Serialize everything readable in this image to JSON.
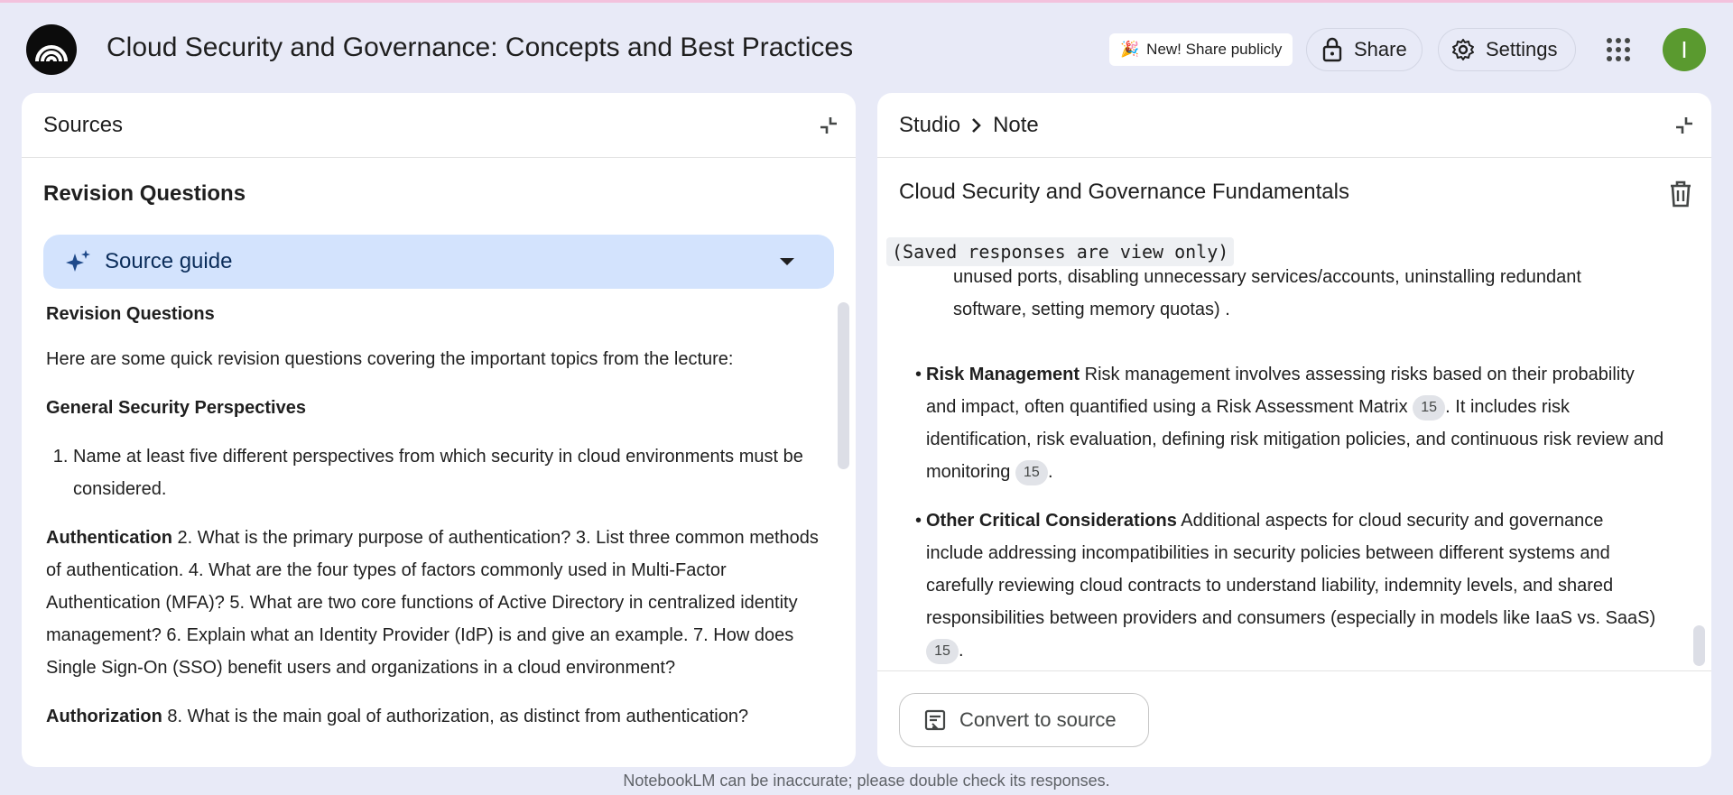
{
  "header": {
    "title": "Cloud Security and Governance: Concepts and Best Practices",
    "share_public_emoji": "🎉",
    "share_public_label": "New! Share publicly",
    "share_label": "Share",
    "settings_label": "Settings",
    "avatar_letter": "I"
  },
  "sources_panel": {
    "title": "Sources",
    "heading": "Revision Questions",
    "source_guide_label": "Source guide",
    "content": {
      "title": "Revision Questions",
      "intro": "Here are some quick revision questions covering the important topics from the lecture:",
      "section1_title": "General Security Perspectives",
      "q1": "Name at least five different perspectives from which security in cloud environments must be considered.",
      "auth_label": "Authentication",
      "auth_text": " 2. What is the primary purpose of authentication? 3. List three common methods of authentication. 4. What are the four types of factors commonly used in Multi-Factor Authentication (MFA)? 5. What are two core functions of Active Directory in centralized identity management? 6. Explain what an Identity Provider (IdP) is and give an example. 7. How does Single Sign-On (SSO) benefit users and organizations in a cloud environment?",
      "authz_label": "Authorization",
      "authz_text": " 8. What is the main goal of authorization, as distinct from authentication?"
    }
  },
  "studio_panel": {
    "breadcrumb_studio": "Studio",
    "breadcrumb_note": "Note",
    "note_title": "Cloud Security and Governance Fundamentals",
    "view_only_label": "(Saved responses are view only)",
    "top_fragment": "unused ports, disabling unnecessary services/accounts, uninstalling redundant software, setting memory quotas) .",
    "risk": {
      "label": "Risk Management",
      "text1": " Risk management involves assessing risks based on their probability and impact, often quantified using a Risk Assessment Matrix ",
      "cite1": "15",
      "text2": ". It includes risk identification, risk evaluation, defining risk mitigation policies, and continuous risk review and monitoring ",
      "cite2": "15",
      "text3": "."
    },
    "other": {
      "label": "Other Critical Considerations",
      "text1": " Additional aspects for cloud security and governance include addressing incompatibilities in security policies between different systems and carefully reviewing cloud contracts to understand liability, indemnity levels, and shared responsibilities between providers and consumers (especially in models like IaaS vs. SaaS) ",
      "cite1": "15",
      "text2": "."
    },
    "convert_label": "Convert to source"
  },
  "footer": {
    "disclaimer": "NotebookLM can be inaccurate; please double check its responses."
  },
  "colors": {
    "background": "#e8eaf7",
    "source_guide_bg": "#d3e3fd",
    "avatar_bg": "#5a9a2f"
  },
  "icons": [
    "notebooklm-logo-icon",
    "lock-icon",
    "gear-icon",
    "apps-grid-icon",
    "collapse-icon",
    "sparkle-icon",
    "dropdown-caret-icon",
    "chevron-right-icon",
    "trash-icon",
    "convert-note-icon"
  ]
}
